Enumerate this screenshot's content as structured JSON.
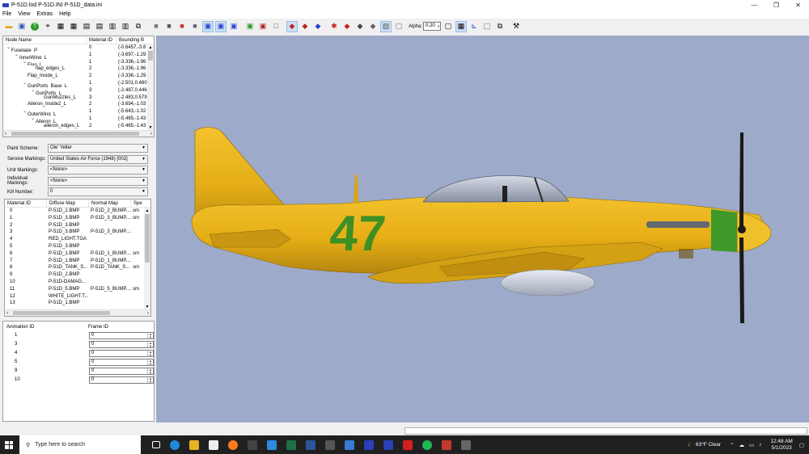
{
  "window": {
    "title": "P-51D.lod  P-51D.INI  P-51D_data.ini",
    "min": "—",
    "max": "❐",
    "close": "✕"
  },
  "menu": [
    "File",
    "View",
    "Extras",
    "Help"
  ],
  "toolbar": {
    "alpha_label": "Alpha:",
    "alpha_value": "0.20"
  },
  "tree": {
    "headers": [
      "Node Name",
      "Material ID",
      "Bounding B"
    ],
    "rows": [
      {
        "name": "Fuselage_P",
        "mat": "0",
        "bb": "(-0.6457,-3.8",
        "depth": 0,
        "toggle": "⌄"
      },
      {
        "name": "InnerWing_L",
        "mat": "1",
        "bb": "(-3.697,-1.29",
        "depth": 1,
        "toggle": "⌄"
      },
      {
        "name": "Flap_L",
        "mat": "1",
        "bb": "(-3.336,-1.96",
        "depth": 2,
        "toggle": "⌄"
      },
      {
        "name": "flap_edges_L",
        "mat": "2",
        "bb": "(-3.336,-1.96",
        "depth": 3,
        "toggle": ""
      },
      {
        "name": "Flap_Inside_L",
        "mat": "2",
        "bb": "(-3.336,-1.29",
        "depth": 2,
        "toggle": ""
      },
      {
        "name": "GunPorts_Base_L",
        "mat": "1",
        "bb": "(-2.501,0.480",
        "depth": 2,
        "toggle": "⌄"
      },
      {
        "name": "GunPorts_L",
        "mat": "3",
        "bb": "(-2.487,0.446",
        "depth": 3,
        "toggle": "⌄"
      },
      {
        "name": "GunMuzzles_L",
        "mat": "3",
        "bb": "(-2.483,0.579",
        "depth": 4,
        "toggle": ""
      },
      {
        "name": "Aileron_Inside2_L",
        "mat": "2",
        "bb": "(-3.694,-1.03",
        "depth": 2,
        "toggle": ""
      },
      {
        "name": "OuterWing_L",
        "mat": "1",
        "bb": "(-5.643,-1.02",
        "depth": 2,
        "toggle": "⌄"
      },
      {
        "name": "Aileron_L",
        "mat": "1",
        "bb": "(-5.465,-1.43",
        "depth": 3,
        "toggle": "⌄"
      },
      {
        "name": "aileron_edges_L",
        "mat": "2",
        "bb": "(-5.465,-1.43",
        "depth": 4,
        "toggle": ""
      }
    ]
  },
  "markings": [
    {
      "label": "Paint Scheme:",
      "value": "Ole' Yeller"
    },
    {
      "label": "Service Markings:",
      "value": "United States Air Force (1948) [002]"
    },
    {
      "label": "Unit Markings:",
      "value": "<None>"
    },
    {
      "label": "Individual Markings:",
      "value": "<None>"
    },
    {
      "label": "Kill Number:",
      "value": "0"
    }
  ],
  "materials": {
    "headers": [
      "Material ID",
      "Diffuse Map",
      "Normal Map",
      "Spe"
    ],
    "rows": [
      [
        "0",
        "P-51D_2.BMP",
        "P-51D_2_BUMP....",
        "sm"
      ],
      [
        "1",
        "P-51D_3.BMP",
        "P-51D_3_BUMP....",
        "sm"
      ],
      [
        "2",
        "P-51D_3.BMP",
        "",
        ""
      ],
      [
        "3",
        "P-51D_3.BMP",
        "P-51D_3_BUMP....",
        ""
      ],
      [
        "4",
        "RED_LIGHT.TGA",
        "",
        ""
      ],
      [
        "5",
        "P-51D_3.BMP",
        "",
        ""
      ],
      [
        "6",
        "P-51D_1.BMP",
        "P-51D_1_BUMP....",
        "sm"
      ],
      [
        "7",
        "P-51D_1.BMP",
        "P-51D_1_BUMP....",
        ""
      ],
      [
        "8",
        "P-51D_TANK_S...",
        "P-51D_TANK_S...",
        "sm"
      ],
      [
        "9",
        "P-51D_2.BMP",
        "",
        ""
      ],
      [
        "10",
        "P-51D-DAMAG...",
        "",
        ""
      ],
      [
        "11",
        "P-51D_5.BMP",
        "P-51D_5_BUMP....",
        "sm"
      ],
      [
        "12",
        "WHITE_LIGHT.T...",
        "",
        ""
      ],
      [
        "13",
        "P-51D_1.BMP",
        "",
        ""
      ]
    ]
  },
  "animation": {
    "headers": [
      "Animation ID",
      "Frame ID"
    ],
    "rows": [
      [
        "1",
        "0"
      ],
      [
        "3",
        "0"
      ],
      [
        "4",
        "0"
      ],
      [
        "5",
        "0"
      ],
      [
        "9",
        "0"
      ],
      [
        "10",
        "0"
      ]
    ]
  },
  "aircraft": {
    "number": "47"
  },
  "taskbar": {
    "search_placeholder": "Type here to search",
    "weather": "63°F  Clear",
    "time": "12:48 AM",
    "date": "5/1/2023"
  }
}
